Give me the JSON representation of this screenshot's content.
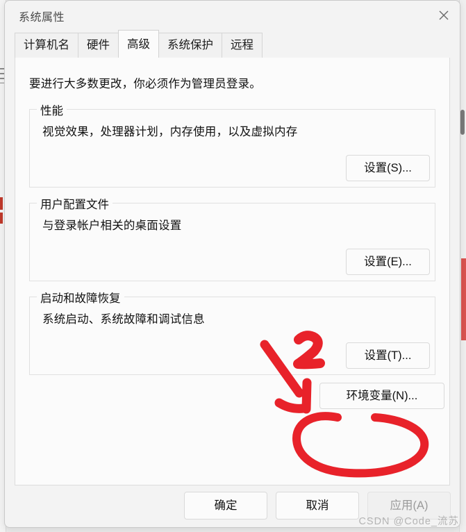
{
  "window": {
    "title": "系统属性",
    "close_label": "✕",
    "close_icon": "close-icon"
  },
  "tabs": [
    {
      "label": "计算机名",
      "active": false
    },
    {
      "label": "硬件",
      "active": false
    },
    {
      "label": "高级",
      "active": true
    },
    {
      "label": "系统保护",
      "active": false
    },
    {
      "label": "远程",
      "active": false
    }
  ],
  "pane": {
    "admin_note": "要进行大多数更改，你必须作为管理员登录。",
    "groups": [
      {
        "legend": "性能",
        "description": "视觉效果，处理器计划，内存使用，以及虚拟内存",
        "button": "设置(S)..."
      },
      {
        "legend": "用户配置文件",
        "description": "与登录帐户相关的桌面设置",
        "button": "设置(E)..."
      },
      {
        "legend": "启动和故障恢复",
        "description": "系统启动、系统故障和调试信息",
        "button": "设置(T)..."
      }
    ],
    "env_button": "环境变量(N)..."
  },
  "commands": {
    "ok": "确定",
    "cancel": "取消",
    "apply": "应用(A)",
    "apply_disabled": true
  },
  "annotations": {
    "step_number": "2",
    "accent_color": "#e8222a",
    "arrow_name": "red-arrow-annotation",
    "circle_name": "red-circle-annotation"
  },
  "watermark": "CSDN @Code_流苏"
}
